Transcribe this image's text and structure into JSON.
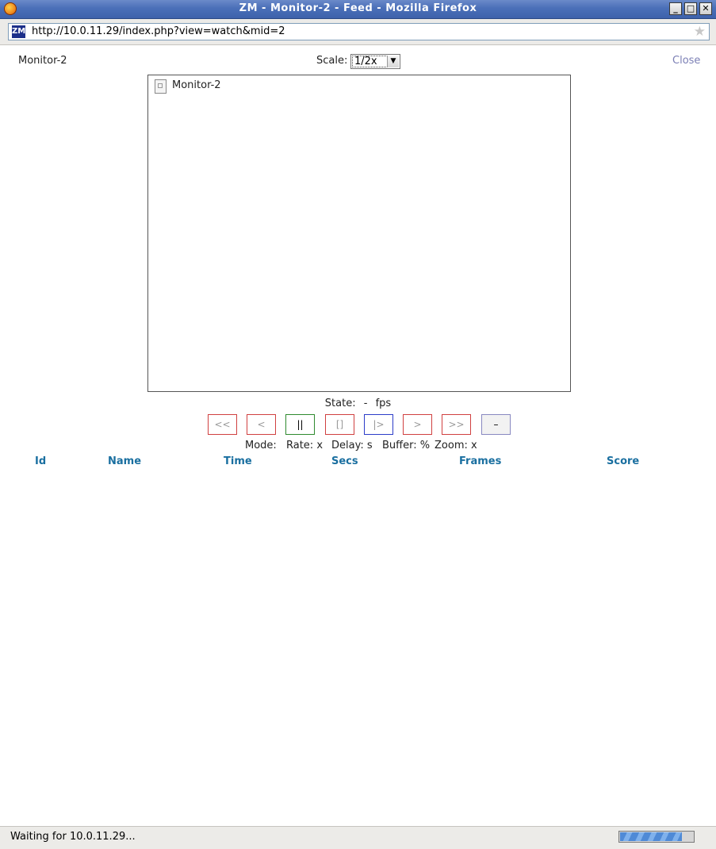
{
  "window": {
    "title": "ZM - Monitor-2 - Feed - Mozilla Firefox",
    "buttons": {
      "minimize": "_",
      "maximize": "□",
      "close": "✕"
    },
    "app_icon": "firefox-icon"
  },
  "location_bar": {
    "site_icon_text": "ZM",
    "url": "http://10.0.11.29/index.php?view=watch&mid=2",
    "bookmark_icon": "★"
  },
  "page": {
    "monitor_name": "Monitor-2",
    "scale_label": "Scale:",
    "scale_value": "1/2x",
    "close_label": "Close",
    "feed_alt_text": "Monitor-2",
    "state": {
      "label": "State:",
      "value": "-",
      "fps": "fps"
    },
    "controls": [
      {
        "label": "<<",
        "name": "fast-rewind-button",
        "border": "red"
      },
      {
        "label": "<",
        "name": "slow-rewind-button",
        "border": "red"
      },
      {
        "label": "||",
        "name": "pause-button",
        "border": "green"
      },
      {
        "label": "[]",
        "name": "stop-button",
        "border": "red"
      },
      {
        "label": "|>",
        "name": "play-button",
        "border": "blue"
      },
      {
        "label": ">",
        "name": "slow-forward-button",
        "border": "red"
      },
      {
        "label": ">>",
        "name": "fast-forward-button",
        "border": "red"
      },
      {
        "label": "–",
        "name": "zoom-out-button",
        "border": "gray"
      }
    ],
    "mode_row": {
      "mode": "Mode:",
      "rate": "Rate: x",
      "delay": "Delay: s",
      "buffer": "Buffer: %",
      "zoom": "Zoom: x"
    },
    "events_columns": [
      "Id",
      "Name",
      "Time",
      "Secs",
      "Frames",
      "Score"
    ]
  },
  "status_bar": {
    "text": "Waiting for 10.0.11.29...",
    "progress": 0.85
  },
  "colors": {
    "titlebar": "#4a6fb8",
    "header_link": "#1a6fa0",
    "close_link": "#7b7fb5",
    "control_red": "#d04040",
    "control_green": "#2f8a2f",
    "control_blue": "#2c3cc8"
  }
}
